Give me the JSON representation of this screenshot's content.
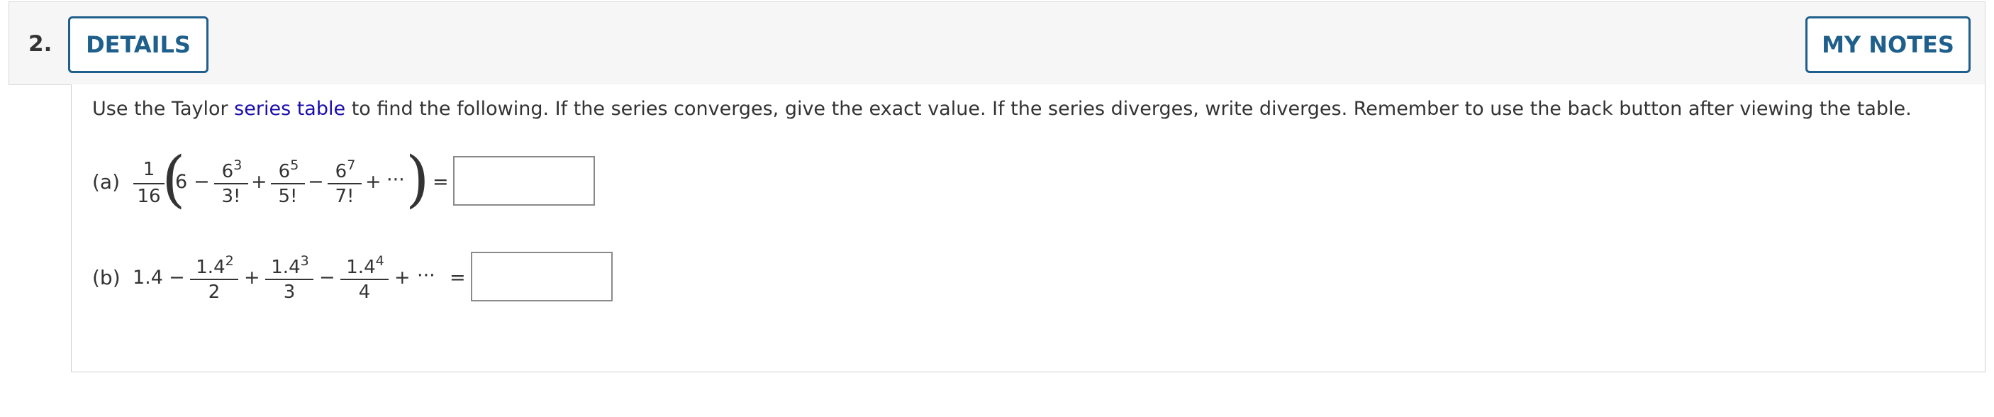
{
  "question": {
    "number": "2.",
    "details_label": "DETAILS",
    "notes_label": "MY NOTES"
  },
  "instructions": {
    "before_link": "Use the Taylor ",
    "link_text": "series table",
    "after_link": " to find the following. If the series converges, give the exact value. If the series diverges, write diverges. Remember to use the back button after viewing the table."
  },
  "part_a": {
    "label": "(a)",
    "coef_num": "1",
    "coef_den": "16",
    "first_term": "6",
    "term2_num": "6",
    "term2_exp": "3",
    "term2_den": "3!",
    "term3_num": "6",
    "term3_exp": "5",
    "term3_den": "5!",
    "term4_num": "6",
    "term4_exp": "7",
    "term4_den": "7!",
    "minus": "−",
    "plus": "+",
    "ellipsis": "···",
    "equals": "=",
    "open_paren": "(",
    "close_paren": ")",
    "answer_value": ""
  },
  "part_b": {
    "label": "(b)",
    "first_term": "1.4",
    "term2_num": "1.4",
    "term2_exp": "2",
    "term2_den": "2",
    "term3_num": "1.4",
    "term3_exp": "3",
    "term3_den": "3",
    "term4_num": "1.4",
    "term4_exp": "4",
    "term4_den": "4",
    "minus": "−",
    "plus": "+",
    "ellipsis": "···",
    "equals": "=",
    "answer_value": ""
  }
}
